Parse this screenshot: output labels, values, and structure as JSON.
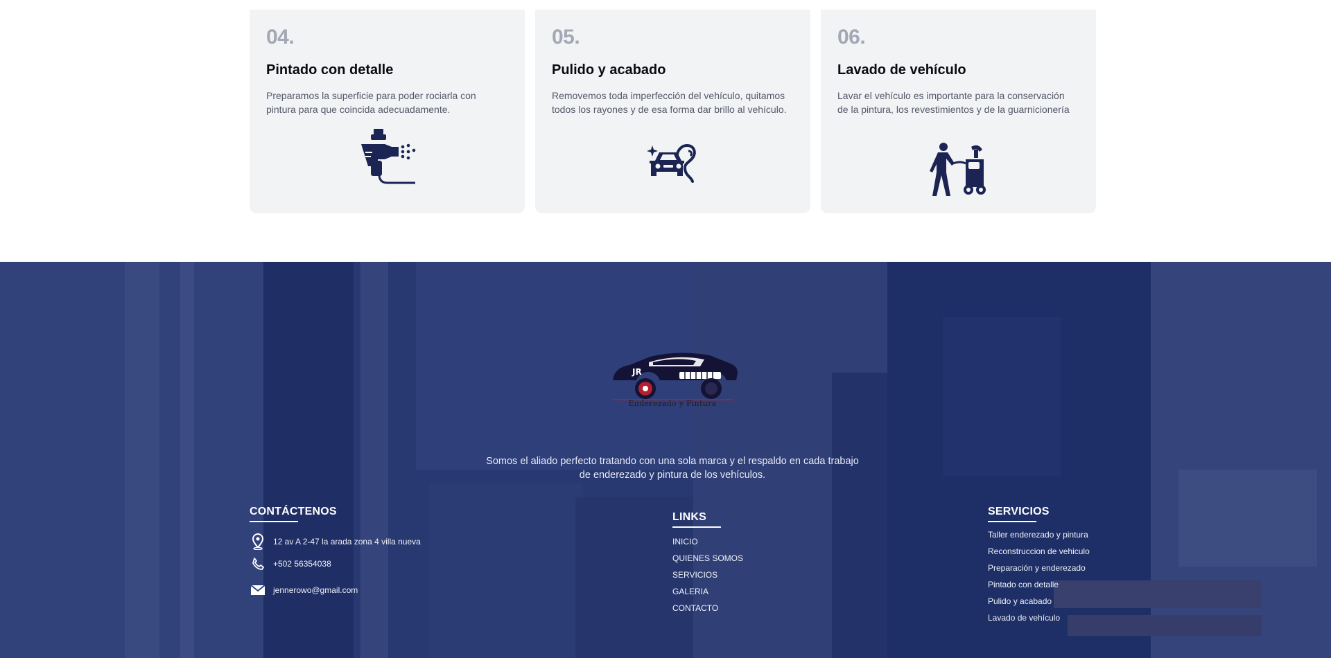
{
  "cards": [
    {
      "number": "04.",
      "title": "Pintado con detalle",
      "description": "Preparamos la superficie para poder rociarla con pintura para que coincida adecuadamente.",
      "icon": "spray-gun-icon"
    },
    {
      "number": "05.",
      "title": "Pulido y acabado",
      "description": "Removemos toda imperfección del vehículo, quitamos todos los rayones y de esa forma dar brillo al vehículo.",
      "icon": "polished-car-icon"
    },
    {
      "number": "06.",
      "title": "Lavado de vehículo",
      "description": "Lavar el vehículo es importante para la conservación de la pintura, los revestimientos y de la guarnicionería",
      "icon": "car-wash-icon"
    }
  ],
  "footer": {
    "logo_text": "Enderezado y Pintura",
    "tagline": "Somos el aliado perfecto tratando con una sola marca y el respaldo en cada trabajo de enderezado y pintura de los vehículos.",
    "contact": {
      "title": "CONTÁCTENOS",
      "address": "12 av A 2-47 la arada zona 4 villa nueva",
      "phone": "+502 56354038",
      "email": "jennerowo@gmail.com"
    },
    "links": {
      "title": "LINKS",
      "items": [
        "INICIO",
        "QUIENES SOMOS",
        "SERVICIOS",
        "GALERIA",
        "CONTACTO"
      ]
    },
    "services": {
      "title": "SERVICIOS",
      "items": [
        "Taller enderezado y pintura",
        "Reconstruccion de vehiculo",
        "Preparación y enderezado",
        "Pintado con detalle",
        "Pulido y acabado",
        "Lavado de vehículo"
      ]
    }
  },
  "colors": {
    "card_bg": "#f2f3f5",
    "icon_navy": "#1b2452",
    "footer_overlay": "#20306c"
  }
}
